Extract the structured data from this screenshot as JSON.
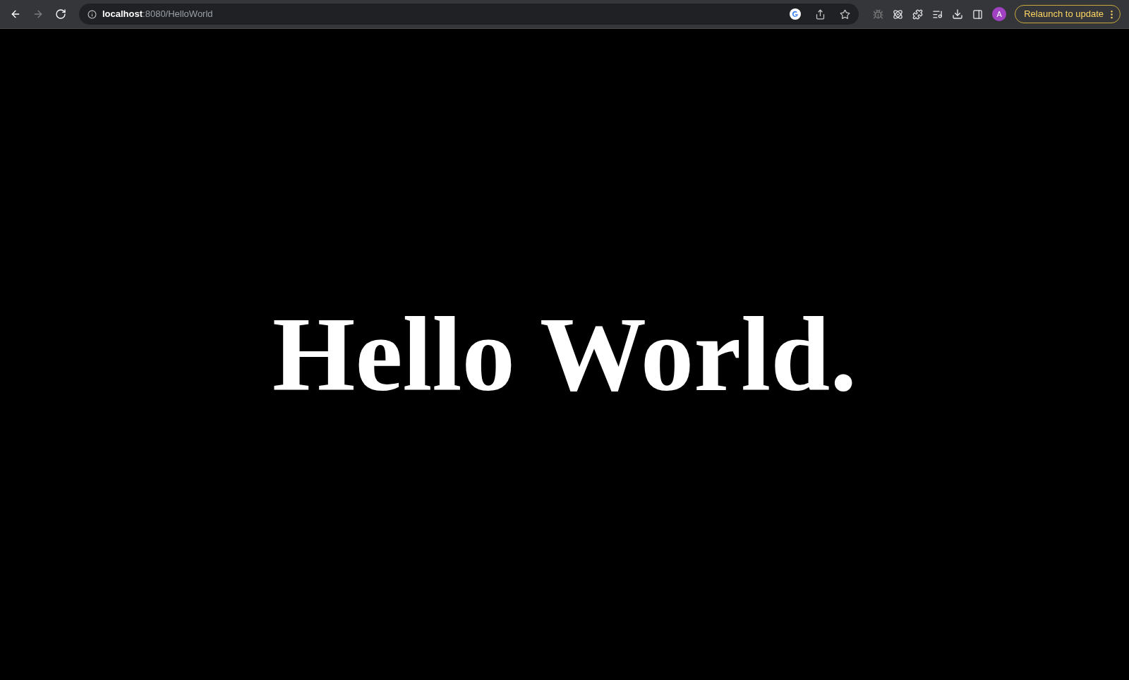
{
  "toolbar": {
    "nav_buttons": [
      {
        "kind": "back",
        "disabled": false
      },
      {
        "kind": "forward",
        "disabled": true
      },
      {
        "kind": "reload",
        "disabled": false
      }
    ],
    "address": "**localhost**:8080/HelloWorld",
    "avatar": "A",
    "update_button": "Relaunch to update"
  },
  "page": {
    "heading": "Hello World."
  }
}
